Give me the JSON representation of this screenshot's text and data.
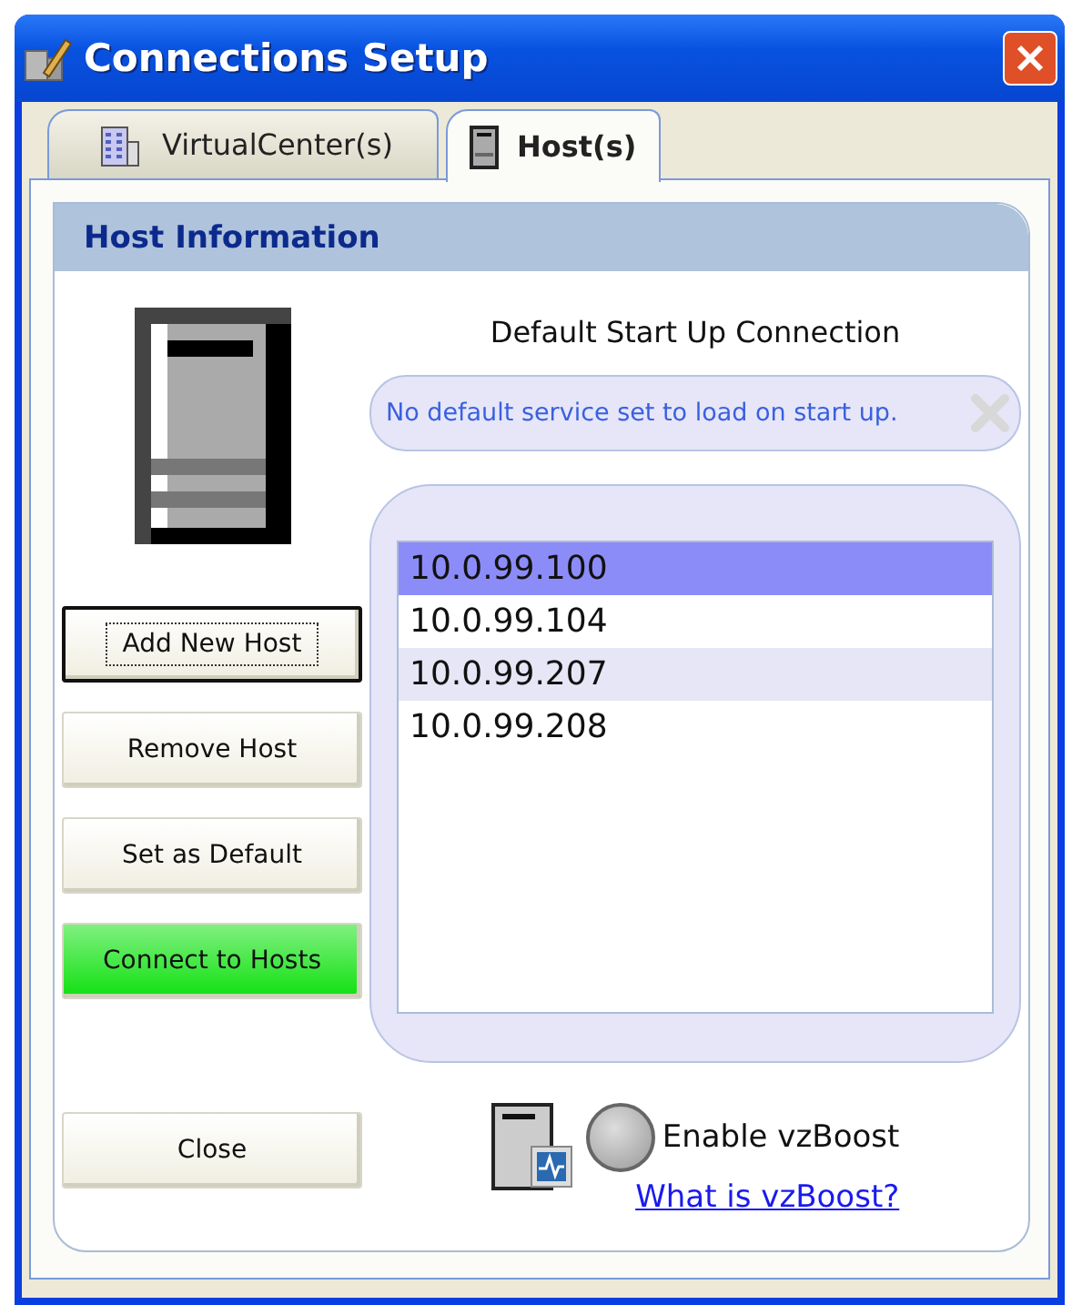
{
  "window": {
    "title": "Connections Setup"
  },
  "tabs": [
    {
      "label": "VirtualCenter(s)",
      "selected": false,
      "kind": "building"
    },
    {
      "label": "Host(s)",
      "selected": true,
      "kind": "server"
    }
  ],
  "panel": {
    "title": "Host Information"
  },
  "default_connection": {
    "heading": "Default Start Up Connection",
    "message": "No default service set to load on start up."
  },
  "buttons": [
    {
      "label": "Add New Host",
      "focused": true,
      "kind": "normal"
    },
    {
      "label": "Remove Host",
      "focused": false,
      "kind": "normal"
    },
    {
      "label": "Set as Default",
      "focused": false,
      "kind": "normal"
    },
    {
      "label": "Connect to Hosts",
      "focused": false,
      "kind": "highlight"
    }
  ],
  "hosts": [
    {
      "address": "10.0.99.100",
      "selected": true
    },
    {
      "address": "10.0.99.104",
      "selected": false
    },
    {
      "address": "10.0.99.207",
      "selected": false
    },
    {
      "address": "10.0.99.208",
      "selected": false
    }
  ],
  "close_button": "Close",
  "vzboost": {
    "label": "Enable vzBoost",
    "on": false,
    "link": "What is vzBoost?"
  }
}
